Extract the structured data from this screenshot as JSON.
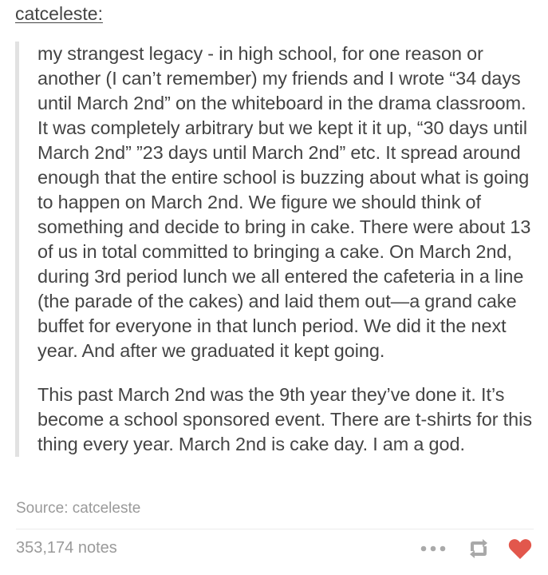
{
  "post": {
    "username": "catceleste",
    "colon": ":",
    "paragraphs": [
      "my strangest legacy - in high school, for one reason or another (I can’t remember) my friends and I wrote “34 days until March 2nd” on the whiteboard in the drama classroom. It was completely arbitrary but we kept it it up, “30 days until March 2nd”  ”23 days until March 2nd” etc. It spread around enough that the entire school is buzzing about what is going to happen on March 2nd. We figure we should think of something and decide to bring in cake. There were about 13 of us in total committed to bringing a cake. On March 2nd, during 3rd period lunch we all entered the cafeteria in a line (the parade of the cakes) and laid them out—a grand cake buffet for everyone in that lunch period. We did it the next year. And after we graduated it kept going.",
      "This past March 2nd was the 9th year they’ve done it. It’s become a school sponsored event. There are t-shirts for this thing every year. March 2nd is cake day. I am a god."
    ],
    "source": "Source: catceleste"
  },
  "footer": {
    "notes": "353,174 notes",
    "icons": {
      "more": "more-dots-icon",
      "reblog": "reblog-icon",
      "like": "heart-icon"
    }
  },
  "colors": {
    "text": "#444444",
    "muted": "#9a9a9a",
    "quote_border": "#e2e2e2",
    "heart": "#e2574c",
    "icon_gray": "#a9a9a9"
  }
}
